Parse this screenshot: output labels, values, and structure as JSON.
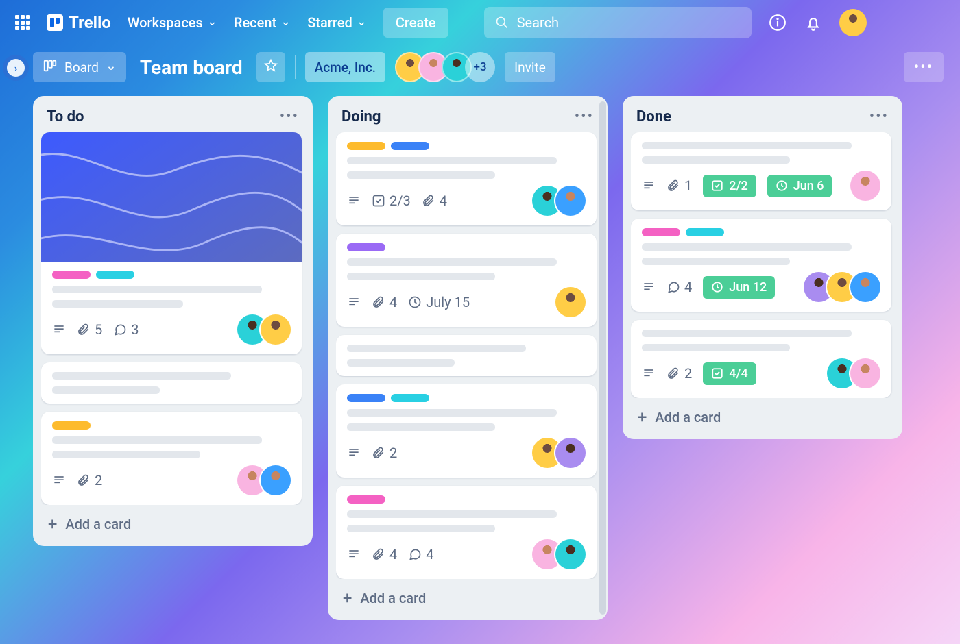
{
  "brand": "Trello",
  "nav": {
    "workspaces": "Workspaces",
    "recent": "Recent",
    "starred": "Starred",
    "create": "Create",
    "search_placeholder": "Search"
  },
  "boardbar": {
    "view_label": "Board",
    "title": "Team board",
    "workspace": "Acme, Inc.",
    "extra_members": "+3",
    "invite": "Invite"
  },
  "add_card_label": "Add a card",
  "lists": [
    {
      "title": "To do",
      "cards": [
        {
          "has_cover": true,
          "labels": [
            "pink",
            "cyan"
          ],
          "attachments": 5,
          "comments": 3,
          "members": [
            "teal",
            "yellow"
          ]
        },
        {
          "placeholder_only": true
        },
        {
          "labels": [
            "yellow"
          ],
          "attachments": 2,
          "members": [
            "pink",
            "blue"
          ]
        }
      ]
    },
    {
      "title": "Doing",
      "cards": [
        {
          "labels": [
            "yellow",
            "blue"
          ],
          "checklist": "2/3",
          "attachments": 4,
          "members": [
            "teal",
            "blue"
          ]
        },
        {
          "labels": [
            "purple"
          ],
          "attachments": 4,
          "due": "July 15",
          "members": [
            "yellow"
          ]
        },
        {
          "placeholder_only": true
        },
        {
          "labels": [
            "blue",
            "cyan"
          ],
          "attachments": 2,
          "members": [
            "yellow",
            "purple"
          ]
        },
        {
          "labels": [
            "pink"
          ],
          "attachments": 4,
          "comments": 4,
          "members": [
            "pink",
            "teal"
          ]
        }
      ]
    },
    {
      "title": "Done",
      "cards": [
        {
          "attachments": 1,
          "checklist_done": "2/2",
          "due_done": "Jun 6",
          "members": [
            "pink"
          ]
        },
        {
          "labels": [
            "pink",
            "cyan"
          ],
          "comments": 4,
          "due_done": "Jun 12",
          "members": [
            "purple",
            "yellow",
            "blue"
          ]
        },
        {
          "attachments": 2,
          "checklist_done": "4/4",
          "members": [
            "teal",
            "pink"
          ]
        }
      ]
    }
  ]
}
